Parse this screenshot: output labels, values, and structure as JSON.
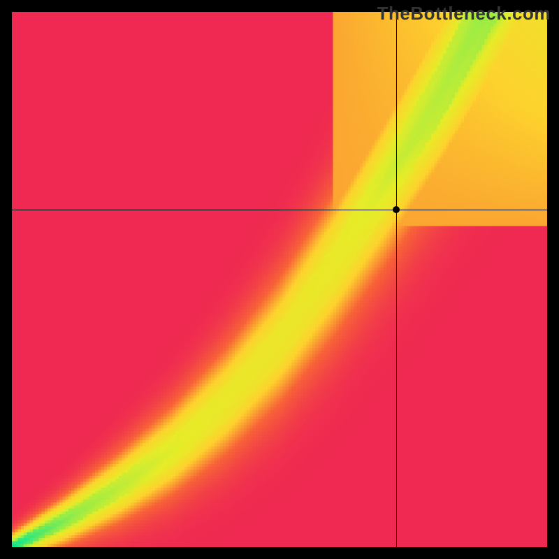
{
  "watermark": "TheBottleneck.com",
  "chart_data": {
    "type": "heatmap",
    "title": "",
    "xlabel": "",
    "ylabel": "",
    "xlim": [
      0,
      1
    ],
    "ylim": [
      0,
      1
    ],
    "grid": false,
    "legend": false,
    "crosshair": {
      "x": 0.718,
      "y": 0.63
    },
    "marker": {
      "x": 0.718,
      "y": 0.63
    },
    "colorscale_note": "value 0=red, 0.5=yellow, 1=green; heatmap encodes match quality",
    "ridge": {
      "description": "green optimal curve through the field",
      "points_xy": [
        [
          0.0,
          0.0
        ],
        [
          0.1,
          0.05
        ],
        [
          0.2,
          0.11
        ],
        [
          0.3,
          0.18
        ],
        [
          0.4,
          0.27
        ],
        [
          0.5,
          0.38
        ],
        [
          0.6,
          0.52
        ],
        [
          0.7,
          0.68
        ],
        [
          0.8,
          0.85
        ],
        [
          0.88,
          1.0
        ]
      ]
    },
    "corner_values_approx": {
      "bottom_left": 0.0,
      "bottom_right": 0.0,
      "top_left": 0.0,
      "top_right": 0.55
    }
  }
}
